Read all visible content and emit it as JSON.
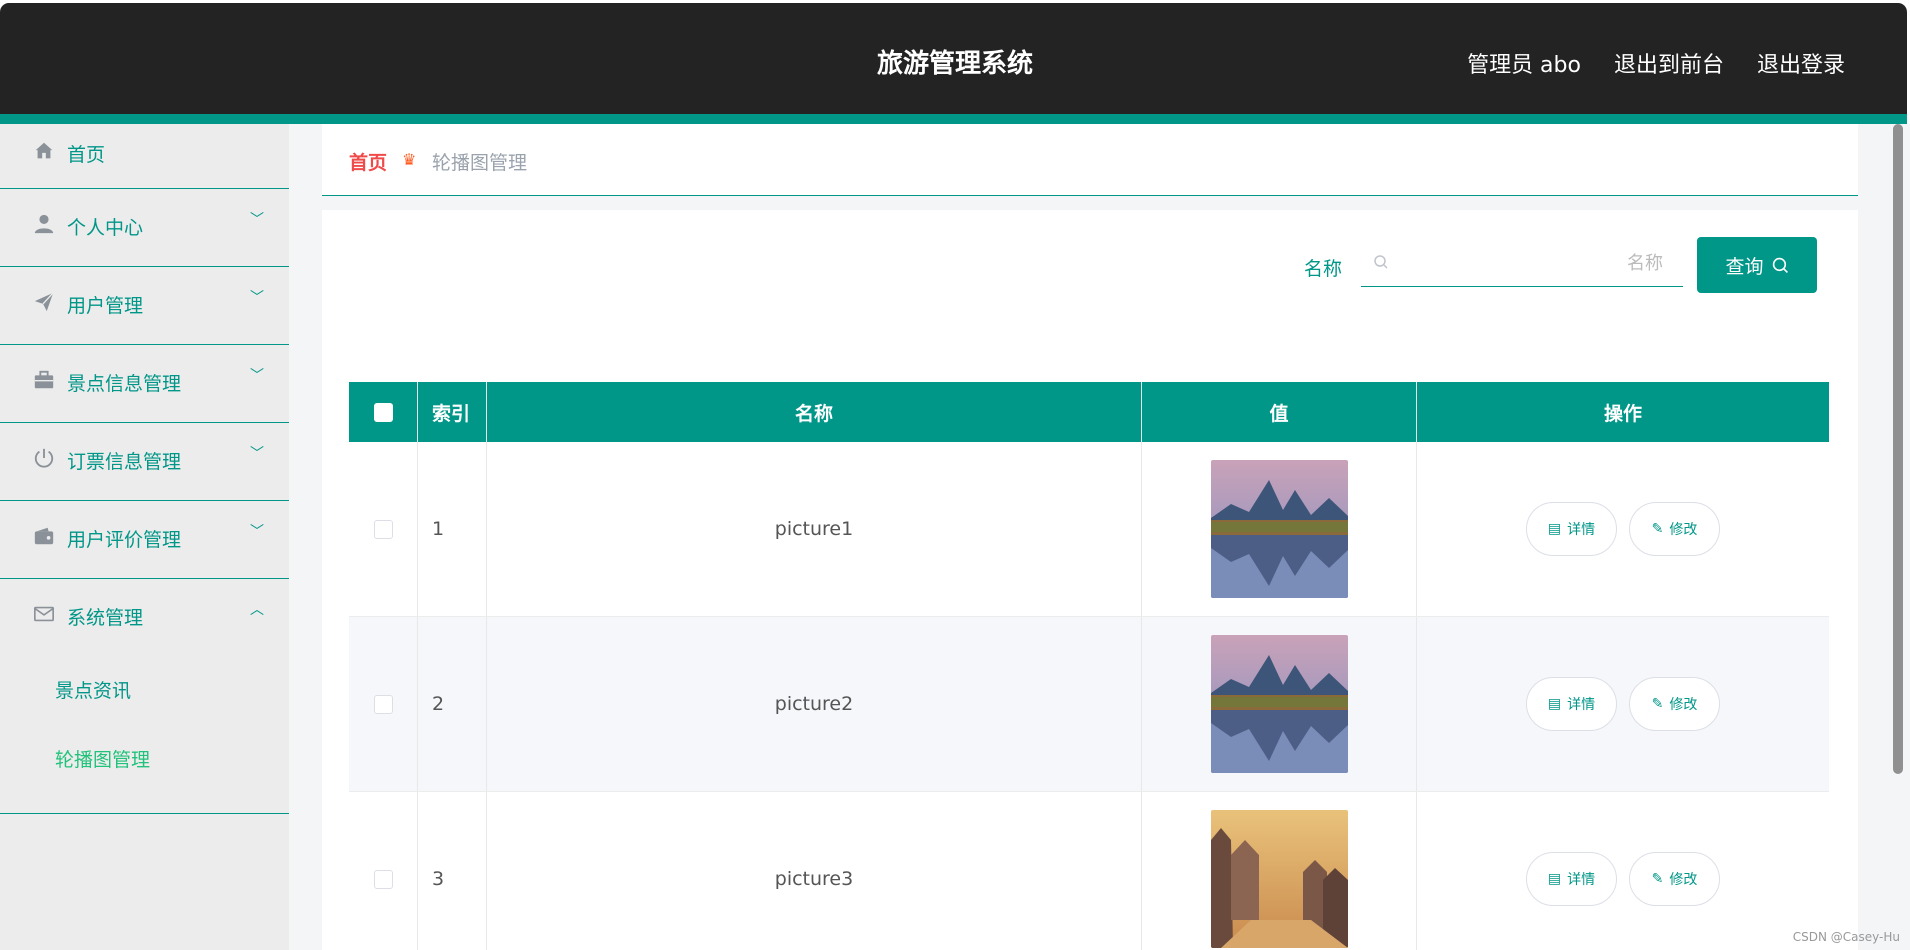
{
  "header": {
    "title": "旅游管理系统",
    "admin_label": "管理员 abo",
    "to_front_label": "退出到前台",
    "logout_label": "退出登录"
  },
  "sidebar": {
    "items": [
      {
        "label": "首页",
        "icon": "home-icon"
      },
      {
        "label": "个人中心",
        "icon": "user-icon"
      },
      {
        "label": "用户管理",
        "icon": "paper-plane-icon"
      },
      {
        "label": "景点信息管理",
        "icon": "briefcase-icon"
      },
      {
        "label": "订票信息管理",
        "icon": "power-icon"
      },
      {
        "label": "用户评价管理",
        "icon": "wallet-icon"
      },
      {
        "label": "系统管理",
        "icon": "mail-icon"
      }
    ],
    "sub_items": [
      {
        "label": "景点资讯"
      },
      {
        "label": "轮播图管理"
      }
    ]
  },
  "breadcrumb": {
    "home": "首页",
    "current": "轮播图管理"
  },
  "search": {
    "label": "名称",
    "placeholder": "名称",
    "button_label": "查询"
  },
  "table": {
    "headers": [
      "索引",
      "名称",
      "值",
      "操作"
    ],
    "rows": [
      {
        "index": "1",
        "name": "picture1"
      },
      {
        "index": "2",
        "name": "picture2"
      },
      {
        "index": "3",
        "name": "picture3"
      }
    ],
    "detail_label": "详情",
    "edit_label": "修改"
  },
  "colors": {
    "accent": "#009688",
    "header_bg": "#232323",
    "breadcrumb_home": "#f04b4b"
  },
  "watermark": "CSDN @Casey-Hu"
}
